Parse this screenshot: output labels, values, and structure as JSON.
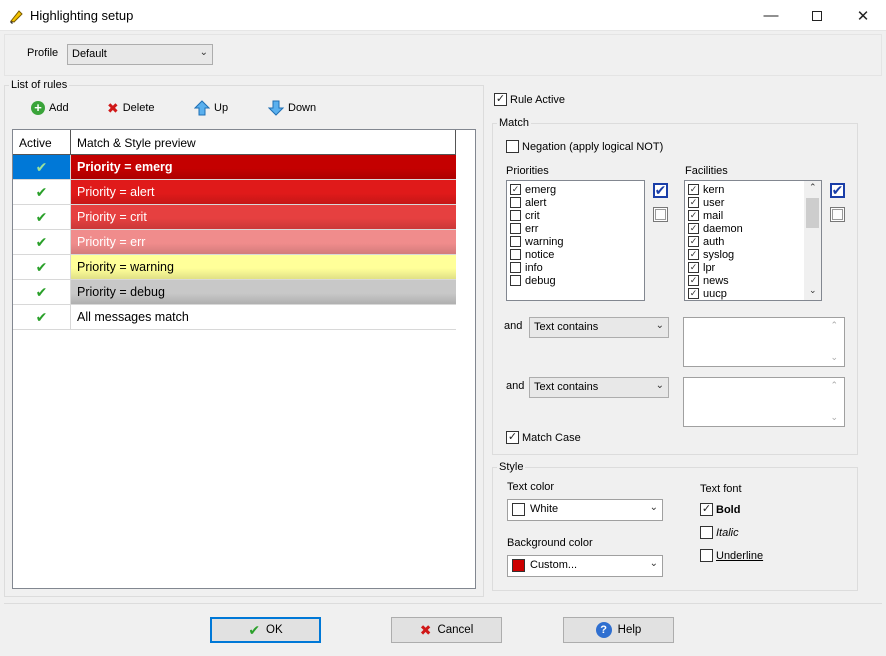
{
  "window": {
    "title": "Highlighting setup"
  },
  "profile": {
    "label": "Profile",
    "value": "Default"
  },
  "rules_group": {
    "title": "List of rules"
  },
  "toolbar": {
    "add": "Add",
    "delete": "Delete",
    "up": "Up",
    "down": "Down"
  },
  "grid": {
    "columns": [
      "Active",
      "Match & Style preview"
    ],
    "rows": [
      {
        "active": "✔",
        "text": "Priority = emerg",
        "bg": "#c40000",
        "fg": "#ffffff",
        "bold": true
      },
      {
        "active": "✔",
        "text": "Priority = alert",
        "bg": "#e01a1a",
        "fg": "#ffffff",
        "bold": false
      },
      {
        "active": "✔",
        "text": "Priority = crit",
        "bg": "#e64040",
        "fg": "#ffffff",
        "bold": false
      },
      {
        "active": "✔",
        "text": "Priority = err",
        "bg": "#f08c8c",
        "fg": "#ffffff",
        "bold": false
      },
      {
        "active": "✔",
        "text": "Priority = warning",
        "bg": "#ffff99",
        "fg": "#000000",
        "bold": false
      },
      {
        "active": "✔",
        "text": "Priority = debug",
        "bg": "#c8c8c8",
        "fg": "#000000",
        "bold": false
      },
      {
        "active": "✔",
        "text": "All messages match",
        "bg": "#ffffff",
        "fg": "#000000",
        "bold": false
      }
    ]
  },
  "rule_active": {
    "label": "Rule Active",
    "checked": true
  },
  "match": {
    "title": "Match",
    "negation": "Negation (apply logical NOT)",
    "priorities_label": "Priorities",
    "priorities": [
      {
        "name": "emerg",
        "checked": true
      },
      {
        "name": "alert",
        "checked": false
      },
      {
        "name": "crit",
        "checked": false
      },
      {
        "name": "err",
        "checked": false
      },
      {
        "name": "warning",
        "checked": false
      },
      {
        "name": "notice",
        "checked": false
      },
      {
        "name": "info",
        "checked": false
      },
      {
        "name": "debug",
        "checked": false
      }
    ],
    "facilities_label": "Facilities",
    "facilities": [
      {
        "name": "kern",
        "checked": true
      },
      {
        "name": "user",
        "checked": true
      },
      {
        "name": "mail",
        "checked": true
      },
      {
        "name": "daemon",
        "checked": true
      },
      {
        "name": "auth",
        "checked": true
      },
      {
        "name": "syslog",
        "checked": true
      },
      {
        "name": "lpr",
        "checked": true
      },
      {
        "name": "news",
        "checked": true
      },
      {
        "name": "uucp",
        "checked": true
      }
    ],
    "and_label_1": "and",
    "text_filter_1": "Text contains",
    "and_label_2": "and",
    "text_filter_2": "Text contains",
    "match_case": "Match Case"
  },
  "style": {
    "title": "Style",
    "text_color_label": "Text color",
    "text_color_value": "White",
    "text_color_swatch": "#ffffff",
    "bg_color_label": "Background color",
    "bg_color_value": "Custom...",
    "bg_color_swatch": "#cc0000",
    "font_label": "Text font",
    "bold": "Bold",
    "italic": "Italic",
    "underline": "Underline"
  },
  "buttons": {
    "ok": "OK",
    "cancel": "Cancel",
    "help": "Help"
  }
}
